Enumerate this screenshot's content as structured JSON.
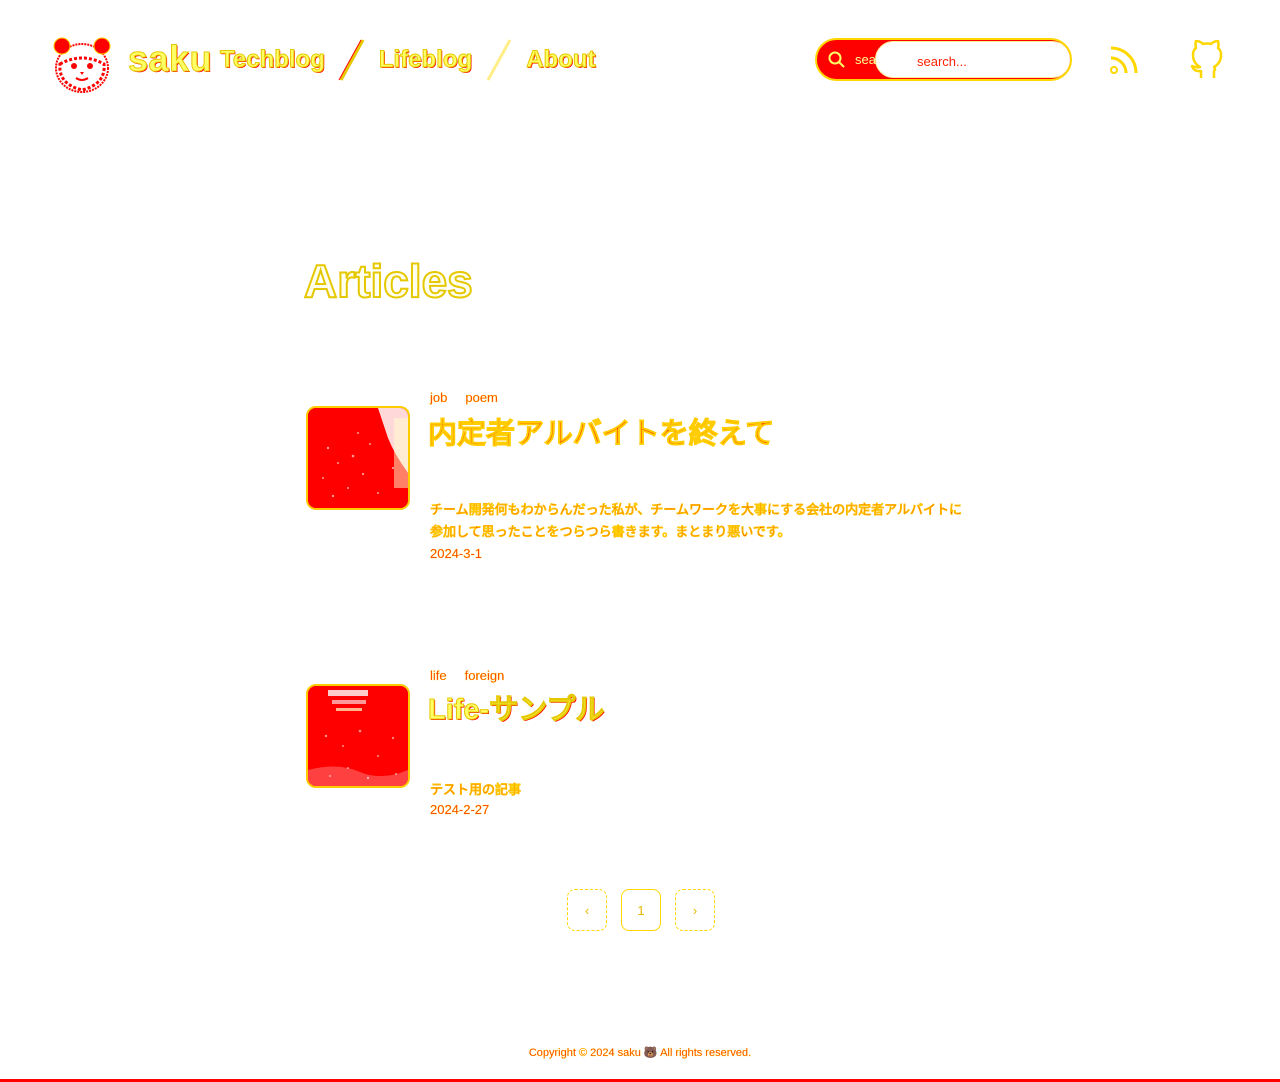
{
  "header": {
    "site_title": "saku",
    "nav": [
      {
        "label": "Techblog"
      },
      {
        "label": "Lifeblog"
      },
      {
        "label": "About"
      }
    ],
    "search": {
      "placeholder": "search...",
      "behind_text": "search..."
    }
  },
  "main": {
    "title": "Articles",
    "articles": [
      {
        "tags": [
          "job",
          "poem"
        ],
        "title": "内定者アルバイトを終えて",
        "excerpt": "チーム開発何もわからんだった私が、チームワークを大事にする会社の内定者アルバイトに参加して思ったことをつらつら書きます。まとまり悪いです。",
        "date": "2024-3-1"
      },
      {
        "tags": [
          "life",
          "foreign"
        ],
        "title": "Life-サンプル",
        "excerpt": "テスト用の記事",
        "date": "2024-2-27"
      }
    ],
    "pagination": {
      "prev": "‹",
      "current": "1",
      "next": "›"
    }
  },
  "footer": {
    "copyright": "Copyright © 2024 saku 🐻 All rights reserved."
  },
  "colors": {
    "primary": "#ff0000",
    "accent": "#ffff66",
    "outline": "#e6c800",
    "background": "#ffffff"
  },
  "icons": [
    "search-icon",
    "rss-icon",
    "github-icon",
    "logo-image"
  ]
}
